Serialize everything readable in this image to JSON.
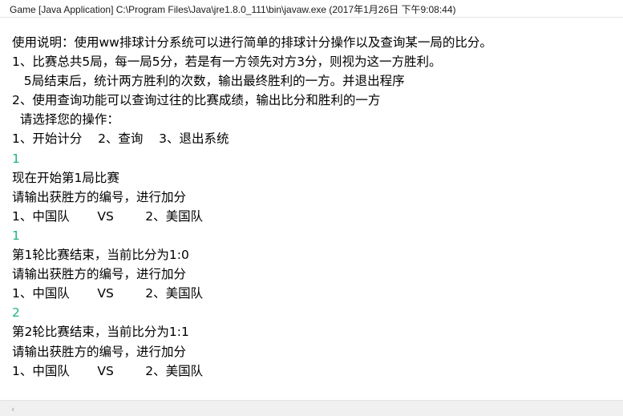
{
  "window": {
    "title": "Game [Java Application] C:\\Program Files\\Java\\jre1.8.0_111\\bin\\javaw.exe (2017年1月26日 下午9:08:44)"
  },
  "console": {
    "lines": [
      {
        "text": "使用说明：使用ww排球计分系统可以进行简单的排球计分操作以及查询某一局的比分。",
        "kind": "output"
      },
      {
        "text": "1、比赛总共5局，每一局5分，若是有一方领先对方3分，则视为这一方胜利。",
        "kind": "output"
      },
      {
        "text": "   5局结束后，统计两方胜利的次数，输出最终胜利的一方。并退出程序",
        "kind": "output"
      },
      {
        "text": "2、使用查询功能可以查询过往的比赛成绩，输出比分和胜利的一方",
        "kind": "output"
      },
      {
        "text": "  请选择您的操作：",
        "kind": "output"
      },
      {
        "text": "1、开始计分    2、查询    3、退出系统",
        "kind": "output"
      },
      {
        "text": "1",
        "kind": "input"
      },
      {
        "text": "现在开始第1局比赛",
        "kind": "output"
      },
      {
        "text": "请输出获胜方的编号，进行加分",
        "kind": "output"
      },
      {
        "text": "1、中国队       VS        2、美国队",
        "kind": "output"
      },
      {
        "text": "1",
        "kind": "input"
      },
      {
        "text": "第1轮比赛结束，当前比分为1:0",
        "kind": "output"
      },
      {
        "text": "请输出获胜方的编号，进行加分",
        "kind": "output"
      },
      {
        "text": "1、中国队       VS        2、美国队",
        "kind": "output"
      },
      {
        "text": "2",
        "kind": "input"
      },
      {
        "text": "第2轮比赛结束，当前比分为1:1",
        "kind": "output"
      },
      {
        "text": "请输出获胜方的编号，进行加分",
        "kind": "output"
      },
      {
        "text": "1、中国队       VS        2、美国队",
        "kind": "output"
      }
    ]
  },
  "scrollbar": {
    "left_arrow_glyph": "‹"
  },
  "colors": {
    "output_text": "#000000",
    "input_text": "#1fb57c"
  }
}
